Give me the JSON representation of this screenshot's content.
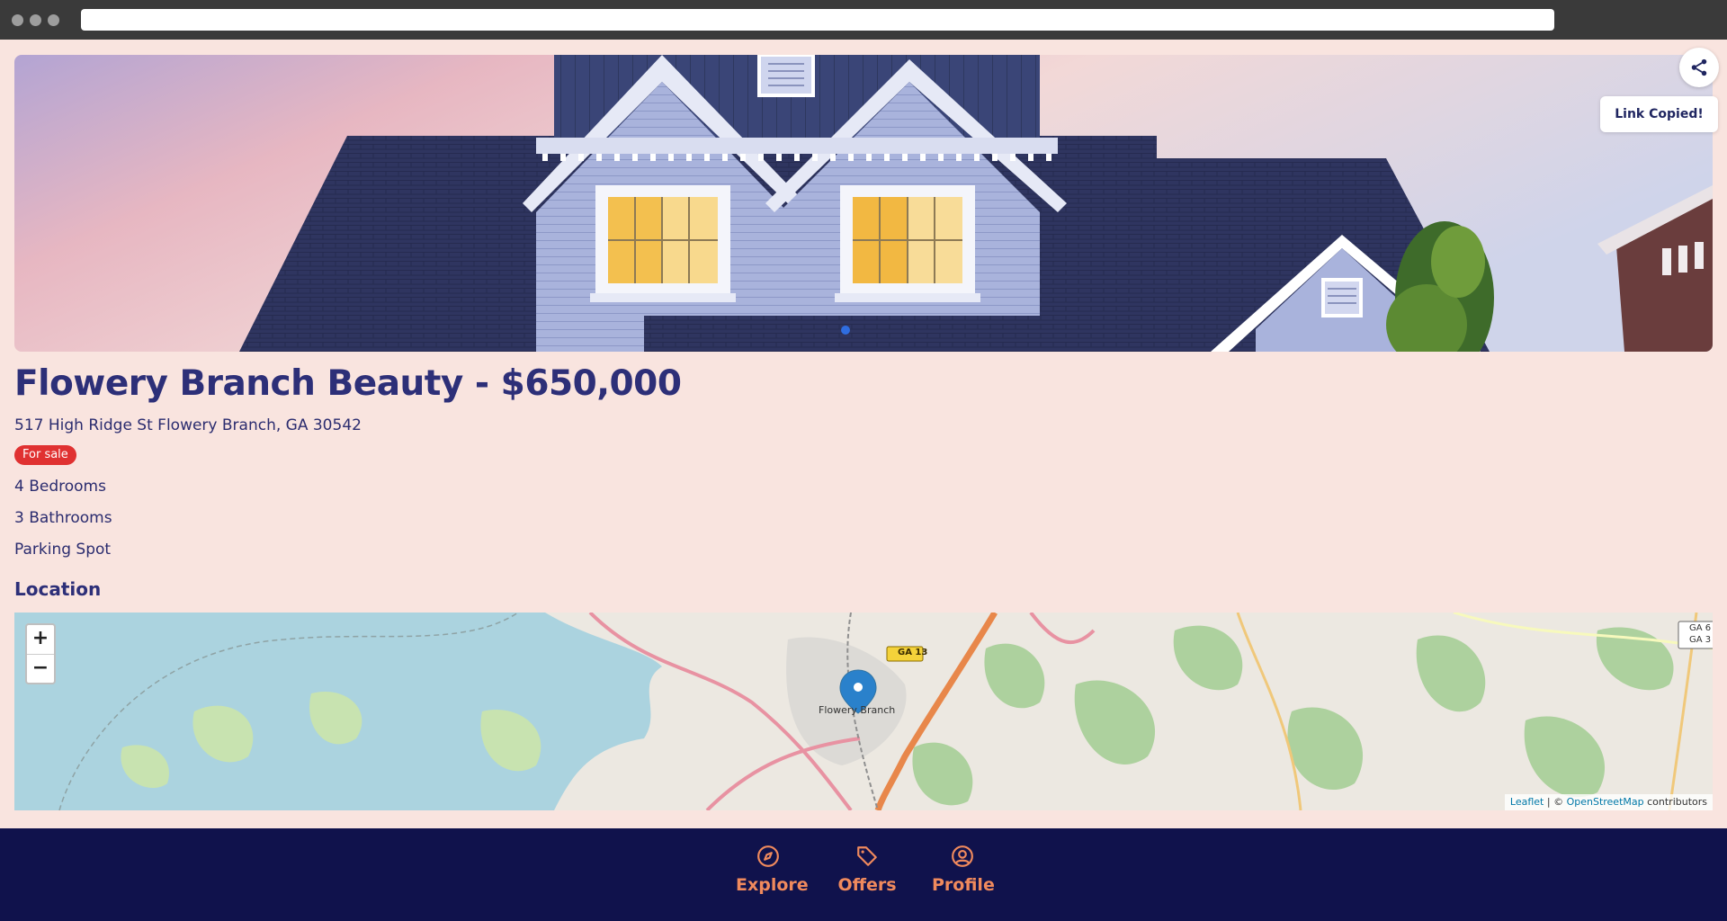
{
  "listing": {
    "title": "Flowery Branch Beauty - $650,000",
    "address": "517 High Ridge St Flowery Branch, GA 30542",
    "status": "For sale",
    "features": [
      "4 Bedrooms",
      "3 Bathrooms",
      "Parking Spot"
    ]
  },
  "gallery": {
    "image_alt": "House exterior photo",
    "active_slide": 1,
    "share_icon": "share-icon",
    "toast": "Link Copied!"
  },
  "location": {
    "heading": "Location",
    "zoom_in": "+",
    "zoom_out": "−",
    "marker_label": "Flowery Branch",
    "road_labels": [
      "GA 13",
      "GA 6",
      "GA 3"
    ],
    "attribution": {
      "leaflet": "Leaflet",
      "separator": " | © ",
      "osm": "OpenStreetMap",
      "suffix": " contributors"
    }
  },
  "nav": {
    "items": [
      {
        "label": "Explore",
        "icon": "compass-icon"
      },
      {
        "label": "Offers",
        "icon": "tag-icon"
      },
      {
        "label": "Profile",
        "icon": "user-circle-icon"
      }
    ]
  },
  "colors": {
    "page_bg": "#f9e4df",
    "heading": "#2d2f78",
    "badge": "#e03131",
    "nav_bg": "#10124c",
    "nav_accent": "#f08a5d"
  }
}
